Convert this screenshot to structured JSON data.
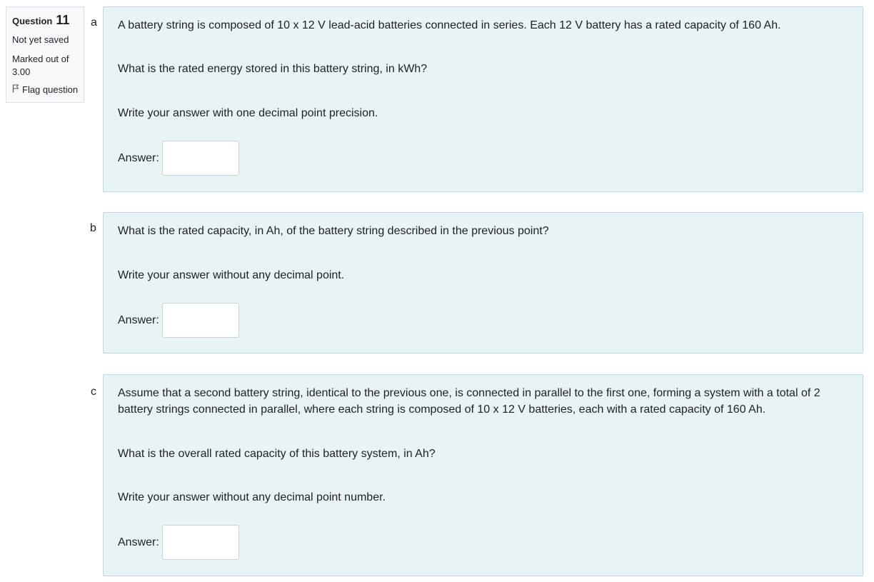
{
  "info": {
    "question_label": "Question",
    "question_number": "11",
    "status": "Not yet saved",
    "marked_line1": "Marked out of",
    "marked_line2": "3.00",
    "flag_label": "Flag question",
    "flag_icon": "flag-icon"
  },
  "parts": [
    {
      "letter": "a",
      "paragraphs": [
        "A battery string is composed of 10 x 12 V lead-acid batteries connected in series.  Each 12 V battery has a rated capacity of 160 Ah.",
        "What is the rated energy stored in this battery string, in kWh?",
        "Write your answer with one decimal point precision."
      ],
      "answer_label": "Answer:",
      "answer_value": ""
    },
    {
      "letter": "b",
      "paragraphs": [
        "What is the rated capacity, in Ah, of the battery string described in the previous point?",
        "Write your answer without any decimal point."
      ],
      "answer_label": "Answer:",
      "answer_value": ""
    },
    {
      "letter": "c",
      "paragraphs": [
        "Assume that a second battery string, identical to the previous one, is connected in parallel to the first one, forming a system with a total of 2 battery strings connected in parallel, where each string is composed of 10 x 12 V batteries, each with a rated capacity of 160 Ah.",
        "What is the overall rated capacity of this battery system, in Ah?",
        "Write your answer without any decimal point number."
      ],
      "answer_label": "Answer:",
      "answer_value": ""
    }
  ],
  "colors": {
    "part_background": "#e7f3f5",
    "part_border": "#b8dce2",
    "info_background": "#f8f9fa"
  }
}
